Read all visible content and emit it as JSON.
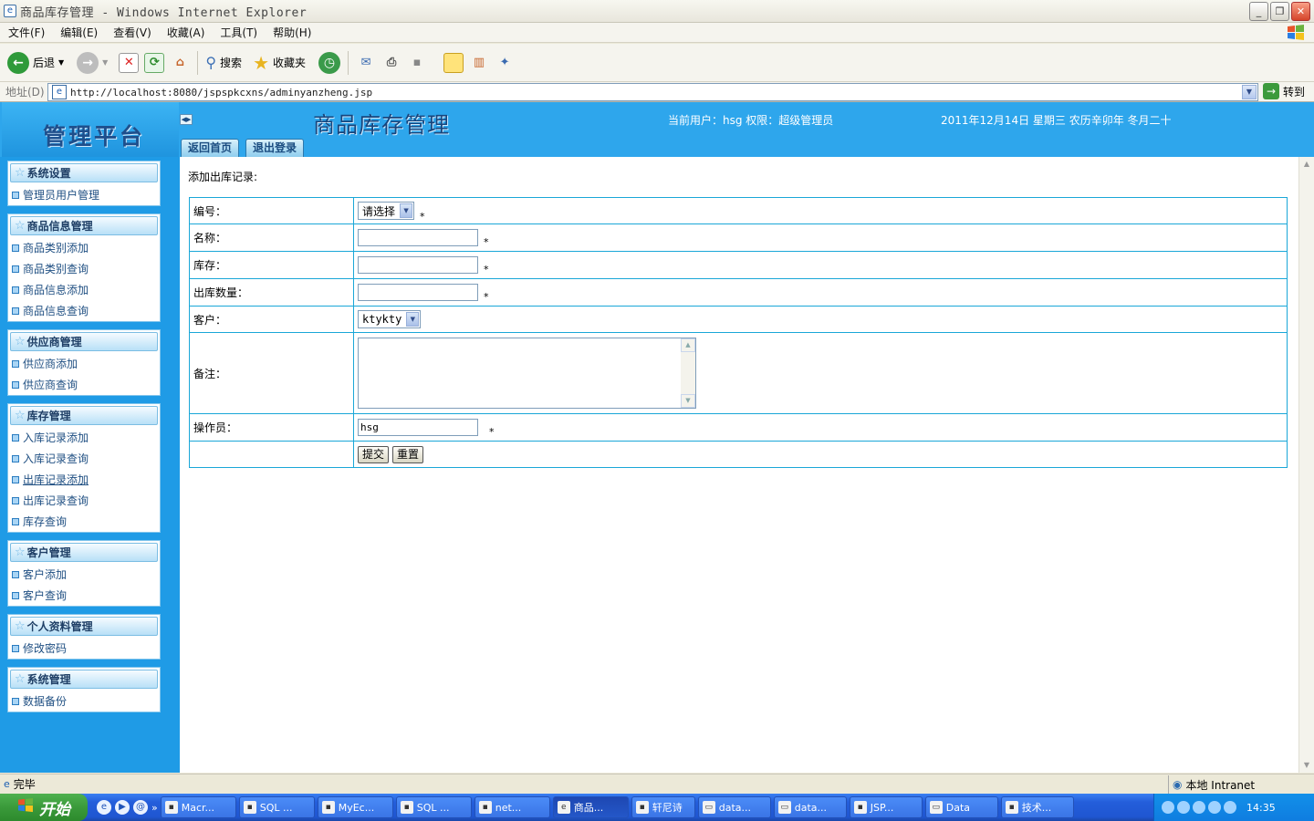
{
  "window": {
    "title": "商品库存管理 - Windows Internet Explorer",
    "buttons": [
      "_",
      "❐",
      "✕"
    ]
  },
  "menu": [
    "文件(F)",
    "编辑(E)",
    "查看(V)",
    "收藏(A)",
    "工具(T)",
    "帮助(H)"
  ],
  "toolbar": {
    "back_label": "后退",
    "search_label": "搜索",
    "favorites_label": "收藏夹"
  },
  "address": {
    "label": "地址(D)",
    "url": "http://localhost:8080/jspspkcxns/adminyanzheng.jsp",
    "go_label": "转到"
  },
  "header": {
    "logo": "管理平台",
    "brand": "商品库存管理",
    "tab_home": "返回首页",
    "tab_logout": "退出登录",
    "user_info": "当前用户：hsg 权限：超级管理员",
    "date_info": "2011年12月14日 星期三 农历辛卯年 冬月二十"
  },
  "sidebar": {
    "sections": [
      {
        "title": "系统设置",
        "items": [
          "管理员用户管理"
        ]
      },
      {
        "title": "商品信息管理",
        "items": [
          "商品类别添加",
          "商品类别查询",
          "商品信息添加",
          "商品信息查询"
        ]
      },
      {
        "title": "供应商管理",
        "items": [
          "供应商添加",
          "供应商查询"
        ]
      },
      {
        "title": "库存管理",
        "items": [
          "入库记录添加",
          "入库记录查询",
          "出库记录添加",
          "出库记录查询",
          "库存查询"
        ]
      },
      {
        "title": "客户管理",
        "items": [
          "客户添加",
          "客户查询"
        ]
      },
      {
        "title": "个人资料管理",
        "items": [
          "修改密码"
        ]
      },
      {
        "title": "系统管理",
        "items": [
          "数据备份"
        ]
      }
    ]
  },
  "form": {
    "caption": "添加出库记录:",
    "required_mark": "*",
    "labels": {
      "code": "编号：",
      "name": "名称：",
      "stock": "库存：",
      "out_qty": "出库数量：",
      "customer": "客户：",
      "remark": "备注：",
      "operator": "操作员："
    },
    "code_selected": "请选择",
    "name_value": "",
    "stock_value": "",
    "out_qty_value": "",
    "customer_selected": "ktykty",
    "remark_value": "",
    "operator_value": "hsg",
    "submit_label": "提交",
    "reset_label": "重置"
  },
  "status": {
    "text": "完毕",
    "zone": "本地 Intranet"
  },
  "taskbar": {
    "start_label": "开始",
    "tasks": [
      "Macr...",
      "SQL ...",
      "MyEc...",
      "SQL ...",
      "net...",
      "商品...",
      "轩尼诗",
      "data...",
      "data...",
      "JSP...",
      "Data",
      "技术..."
    ],
    "clock": "14:35"
  },
  "colors": {
    "header_blue": "#2ea6ec",
    "sidebar_blue": "#1f9be6",
    "table_border": "#1aa7d8"
  }
}
